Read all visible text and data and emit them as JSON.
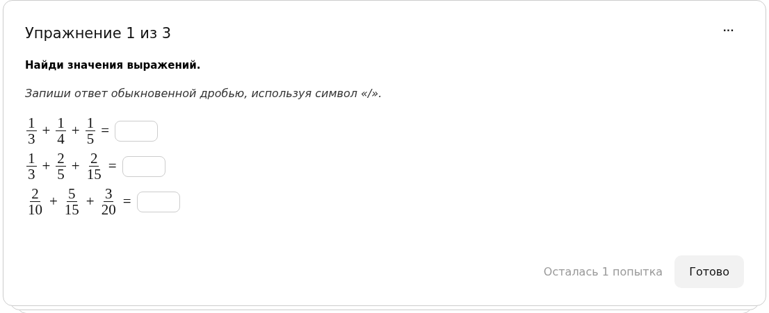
{
  "title": "Упражнение 1 из 3",
  "menu_icon": "···",
  "task": "Найди значения выражений.",
  "hint": "Запиши ответ обыкновенной дробью, используя символ «/».",
  "expressions": [
    {
      "terms": [
        {
          "num": "1",
          "den": "3"
        },
        {
          "num": "1",
          "den": "4"
        },
        {
          "num": "1",
          "den": "5"
        }
      ],
      "operators": [
        "+",
        "+"
      ],
      "equals": "="
    },
    {
      "terms": [
        {
          "num": "1",
          "den": "3"
        },
        {
          "num": "2",
          "den": "5"
        },
        {
          "num": "2",
          "den": "15"
        }
      ],
      "operators": [
        "+",
        "+"
      ],
      "equals": "="
    },
    {
      "terms": [
        {
          "num": "2",
          "den": "10"
        },
        {
          "num": "5",
          "den": "15"
        },
        {
          "num": "3",
          "den": "20"
        }
      ],
      "operators": [
        "+",
        "+"
      ],
      "equals": "="
    }
  ],
  "attempts": "Осталась 1 попытка",
  "submit_button": "Готово"
}
